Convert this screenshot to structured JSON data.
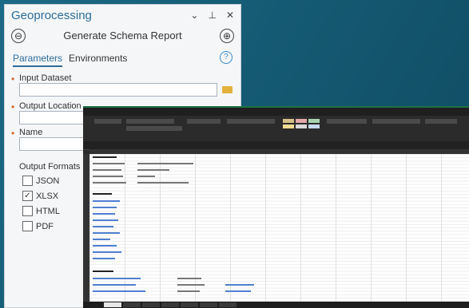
{
  "gp": {
    "title": "Geoprocessing",
    "controls": [
      "⌄",
      "⊥",
      "✕"
    ],
    "back_icon": "⊖",
    "add_icon": "⊕",
    "tool_title": "Generate Schema Report",
    "tabs": [
      "Parameters",
      "Environments"
    ],
    "help_icon": "?",
    "params": [
      {
        "label": "Input Dataset",
        "value": ""
      },
      {
        "label": "Output Location",
        "value": ""
      },
      {
        "label": "Name",
        "value": ""
      }
    ],
    "formats_title": "Output Formats",
    "formats": [
      {
        "label": "JSON",
        "checked": false
      },
      {
        "label": "XLSX",
        "checked": true
      },
      {
        "label": "HTML",
        "checked": false
      },
      {
        "label": "PDF",
        "checked": false
      }
    ]
  },
  "excel": {
    "accent": "#1f7145",
    "link_color": "#4f7fd0"
  }
}
